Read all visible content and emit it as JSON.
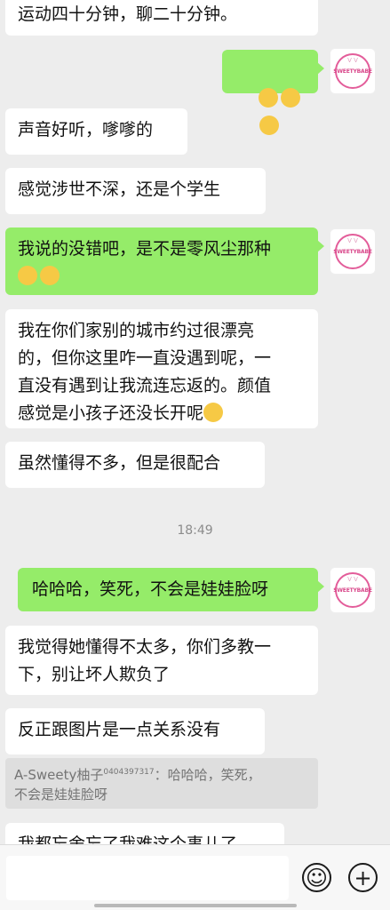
{
  "messages": [
    {
      "text": "运动四十分钟，聊二十分钟。"
    },
    {
      "text": "",
      "emoji": [
        "laughing-tears-emoji",
        "laughing-tears-emoji",
        "laughing-tears-emoji"
      ]
    },
    {
      "text": "声音好听，嗲嗲的"
    },
    {
      "text": "感觉涉世不深，还是个学生"
    },
    {
      "text": "我说的没错吧，是不是零风尘那种\n",
      "emoji": [
        "squinting-emoji",
        "squinting-emoji"
      ]
    },
    {
      "text": "我在你们家别的城市约过很漂亮\n的，但你这里咋一直没遇到呢，一\n直没有遇到让我流连忘返的。颜值\n感觉是小孩子还没长开呢",
      "emoji": [
        "thinking-emoji"
      ]
    },
    {
      "text": "虽然懂得不多，但是很配合"
    },
    {
      "text": "哈哈哈，笑死，不会是娃娃脸呀"
    },
    {
      "text": "我觉得她懂得不太多，你们多教一\n下，别让坏人欺负了"
    },
    {
      "text": "反正跟图片是一点关系没有"
    },
    {
      "text": "我都忘舍忘了我难这个事儿了"
    }
  ],
  "timestamp": "18:49",
  "quote": {
    "sender": "A-Sweety柚子",
    "sender_id": "0404397317",
    "text": "：哈哈哈，笑死，\n不会是娃娃脸呀"
  },
  "avatar": {
    "brand": "SWEETYBABE",
    "mark": "ᐯ ᐯ"
  },
  "composer": {
    "emoji_icon": "smiley-icon",
    "plus_icon": "plus-icon",
    "emoji_glyph": "☺",
    "plus_glyph": "+"
  }
}
